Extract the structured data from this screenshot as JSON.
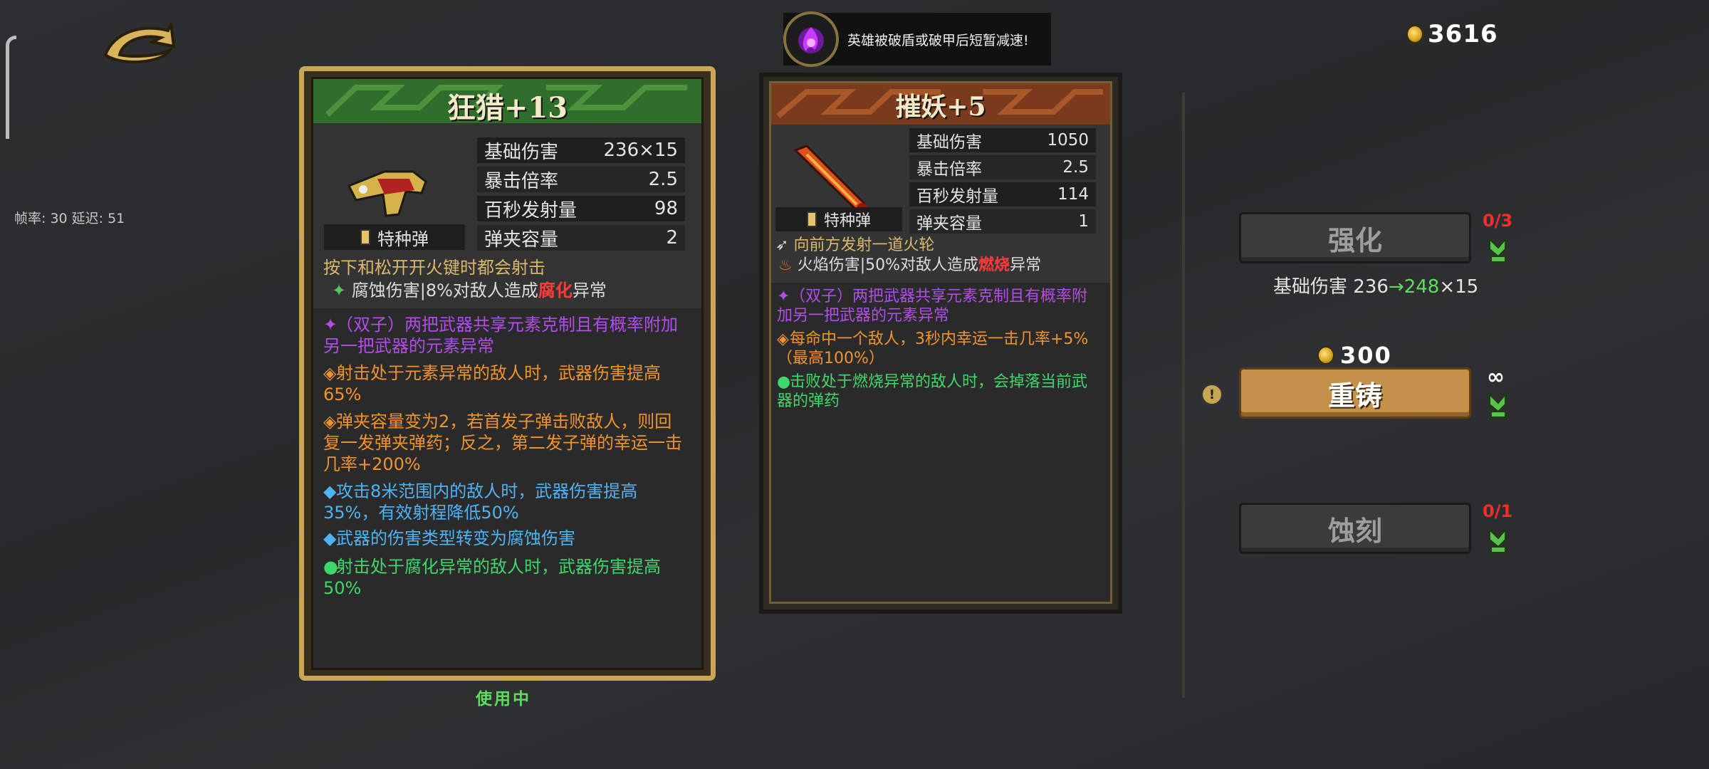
{
  "hud": {
    "fps_text": "帧率: 30    延迟: 51",
    "gold": "3616",
    "notice": "英雄被破盾或破甲后短暂减速!"
  },
  "card1": {
    "title": "狂猎+13",
    "ammo": "特种弹",
    "stats": [
      {
        "label": "基础伤害",
        "value": "236×15"
      },
      {
        "label": "暴击倍率",
        "value": "2.5"
      },
      {
        "label": "百秒发射量",
        "value": "98"
      },
      {
        "label": "弹夹容量",
        "value": "2"
      }
    ],
    "desc1": "按下和松开开火键时都会射击",
    "desc2_pre": "腐蚀伤害|8%对敌人造成",
    "desc2_red": "腐化",
    "desc2_post": "异常",
    "perks": [
      {
        "color": "purple",
        "text": "（双子）两把武器共享元素克制且有概率附加另一把武器的元素异常"
      },
      {
        "color": "orange",
        "text": "射击处于元素异常的敌人时，武器伤害提高65%"
      },
      {
        "color": "orange",
        "text": "弹夹容量变为2，若首发子弹击败敌人，则回复一发弹夹弹药；反之，第二发子弹的幸运一击几率+200%"
      },
      {
        "color": "blue",
        "text": "攻击8米范围内的敌人时，武器伤害提高35%，有效射程降低50%"
      },
      {
        "color": "blue",
        "text": "武器的伤害类型转变为腐蚀伤害"
      },
      {
        "color": "green",
        "text": "射击处于腐化异常的敌人时，武器伤害提高50%"
      }
    ],
    "status": "使用中"
  },
  "card2": {
    "title": "摧妖+5",
    "ammo": "特种弹",
    "stats": [
      {
        "label": "基础伤害",
        "value": "1050"
      },
      {
        "label": "暴击倍率",
        "value": "2.5"
      },
      {
        "label": "百秒发射量",
        "value": "114"
      },
      {
        "label": "弹夹容量",
        "value": "1"
      }
    ],
    "desc1": "向前方发射一道火轮",
    "desc2_pre": "火焰伤害|50%对敌人造成",
    "desc2_red": "燃烧",
    "desc2_post": "异常",
    "perks": [
      {
        "color": "purple",
        "text": "（双子）两把武器共享元素克制且有概率附加另一把武器的元素异常"
      },
      {
        "color": "orange",
        "text": "每命中一个敌人，3秒内幸运一击几率+5%（最高100%）"
      },
      {
        "color": "green",
        "text": "击败处于燃烧异常的敌人时，会掉落当前武器的弹药"
      }
    ]
  },
  "actions": {
    "upgrade_label": "强化",
    "upgrade_count": "0/3",
    "upgrade_info_label": "基础伤害",
    "upgrade_info_from": "236",
    "upgrade_info_arrow": "→",
    "upgrade_info_to": "248",
    "upgrade_info_suffix": "×15",
    "reforge_cost": "300",
    "reforge_label": "重铸",
    "reforge_count": "∞",
    "engrave_label": "蚀刻",
    "engrave_count": "0/1"
  },
  "colors": {
    "purple": "#b04ce8",
    "orange": "#f0932b",
    "blue": "#4fb2f2",
    "green": "#3fd66a",
    "red_count": "#ff2a2a",
    "gold_frame": "#c9a656"
  },
  "icons": {
    "back": "back-arrow-icon",
    "notice": "purple-flame-icon",
    "coin": "gold-coin-icon",
    "weapon1": "shotgun-icon",
    "weapon2": "fire-sword-icon",
    "corrosion": "corrosion-icon",
    "fire": "fire-icon",
    "wind": "wind-icon",
    "up_arrow": "green-up-arrow-icon",
    "info": "info-icon"
  }
}
